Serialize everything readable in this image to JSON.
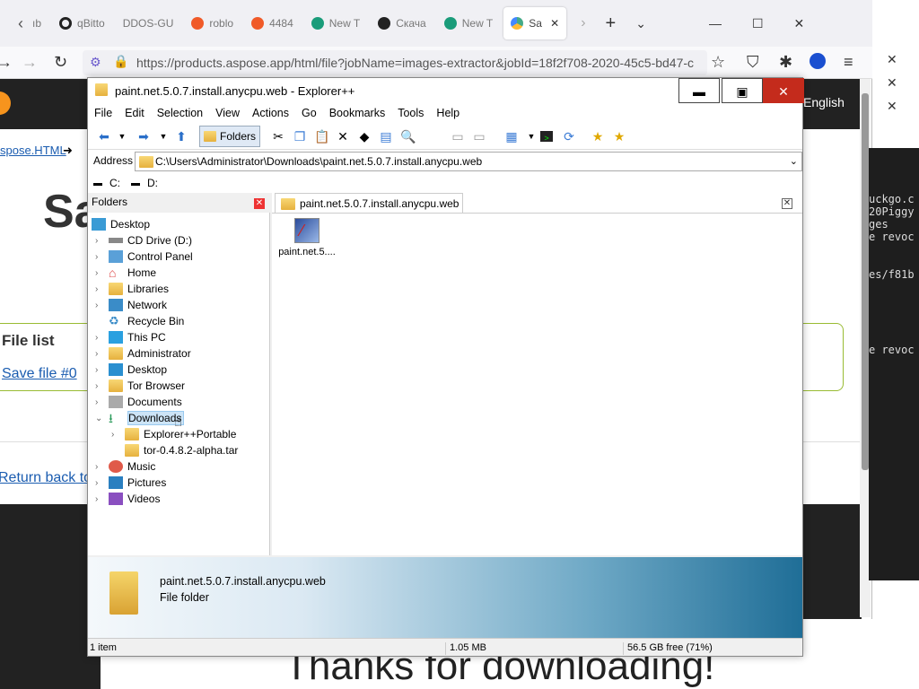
{
  "browser": {
    "tabs": [
      {
        "label": "ıb"
      },
      {
        "label": "qBitto"
      },
      {
        "label": "DDOS-GU"
      },
      {
        "label": "roblo"
      },
      {
        "label": "4484"
      },
      {
        "label": "New T"
      },
      {
        "label": "Скача"
      },
      {
        "label": "New T"
      },
      {
        "label": "Sa"
      }
    ],
    "url": "https://products.aspose.app/html/file?jobName=images-extractor&jobId=18f2f708-2020-45c5-bd47-c"
  },
  "page": {
    "breadcrumb": "spose.HTML",
    "heading": "Sa",
    "language": "English",
    "file_list_title": "File list",
    "save_link": "Save file #0",
    "return_link": "Return back to",
    "thanks": "Thanks for downloading!"
  },
  "terminal": {
    "lines": [
      "uckgo.c",
      "20Piggy",
      "ges",
      "e revoc",
      "",
      "",
      "es/f81b",
      "",
      "",
      "",
      "",
      "",
      "e revoc"
    ]
  },
  "explorer": {
    "title": "paint.net.5.0.7.install.anycpu.web - Explorer++",
    "menu": [
      "File",
      "Edit",
      "Selection",
      "View",
      "Actions",
      "Go",
      "Bookmarks",
      "Tools",
      "Help"
    ],
    "folders_button": "Folders",
    "address_label": "Address",
    "address": "C:\\Users\\Administrator\\Downloads\\paint.net.5.0.7.install.anycpu.web",
    "drives": [
      "C:",
      "D:"
    ],
    "folders_header": "Folders",
    "tree": [
      {
        "label": "Desktop",
        "level": 0
      },
      {
        "label": "CD Drive (D:)",
        "level": 1
      },
      {
        "label": "Control Panel",
        "level": 1
      },
      {
        "label": "Home",
        "level": 1
      },
      {
        "label": "Libraries",
        "level": 1
      },
      {
        "label": "Network",
        "level": 1
      },
      {
        "label": "Recycle Bin",
        "level": 1
      },
      {
        "label": "This PC",
        "level": 1
      },
      {
        "label": "Administrator",
        "level": 1
      },
      {
        "label": "Desktop",
        "level": 1
      },
      {
        "label": "Tor Browser",
        "level": 1
      },
      {
        "label": "Documents",
        "level": 1
      },
      {
        "label": "Downloads",
        "level": 1
      },
      {
        "label": "Explorer++Portable",
        "level": 2
      },
      {
        "label": "tor-0.4.8.2-alpha.tar",
        "level": 2
      },
      {
        "label": "Music",
        "level": 1
      },
      {
        "label": "Pictures",
        "level": 1
      },
      {
        "label": "Videos",
        "level": 1
      }
    ],
    "tab_label": "paint.net.5.0.7.install.anycpu.web",
    "file_label": "paint.net.5....",
    "info_name": "paint.net.5.0.7.install.anycpu.web",
    "info_type": "File folder",
    "status_items": "1 item",
    "status_size": "1.05 MB",
    "status_free": "56.5 GB free (71%)"
  }
}
